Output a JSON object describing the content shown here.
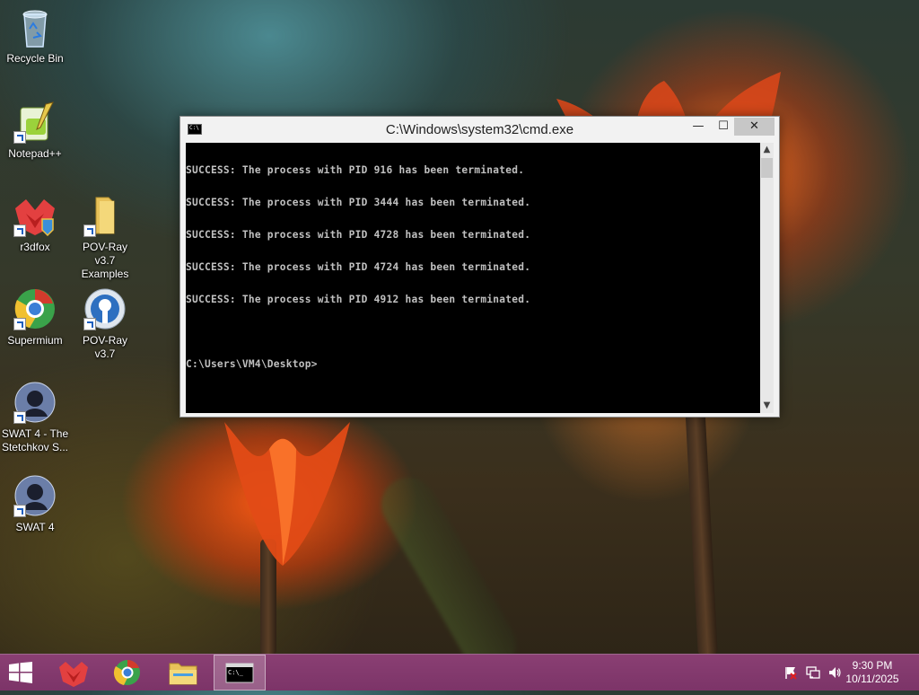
{
  "desktop": {
    "icons": [
      {
        "label": "Recycle Bin",
        "icon": "recycle-bin-icon"
      },
      {
        "label": "Notepad++",
        "icon": "notepad-plus-plus-icon"
      },
      {
        "label": "r3dfox",
        "icon": "r3dfox-icon"
      },
      {
        "label": "POV-Ray v3.7 Examples",
        "icon": "folder-icon"
      },
      {
        "label": "Supermium",
        "icon": "supermium-icon"
      },
      {
        "label": "POV-Ray v3.7",
        "icon": "pov-ray-icon"
      },
      {
        "label": "SWAT 4 - The Stetchkov S...",
        "icon": "swat4-icon"
      },
      {
        "label": "SWAT 4",
        "icon": "swat4-icon"
      }
    ]
  },
  "cmd_window": {
    "title": "C:\\Windows\\system32\\cmd.exe",
    "controls": {
      "minimize": "—",
      "maximize": "☐",
      "close": "✕"
    },
    "lines": [
      "SUCCESS: The process with PID 916 has been terminated.",
      "SUCCESS: The process with PID 3444 has been terminated.",
      "SUCCESS: The process with PID 4728 has been terminated.",
      "SUCCESS: The process with PID 4724 has been terminated.",
      "SUCCESS: The process with PID 4912 has been terminated.",
      "",
      "C:\\Users\\VM4\\Desktop>"
    ]
  },
  "taskbar": {
    "pinned": [
      "r3dfox-icon",
      "supermium-icon",
      "file-explorer-icon",
      "cmd-icon"
    ],
    "active": "cmd-icon",
    "tray": [
      "action-center-flag-icon",
      "network-icon",
      "volume-icon"
    ],
    "time": "9:30 PM",
    "date": "10/11/2025"
  },
  "colors": {
    "taskbar": "#7c3468",
    "console_bg": "#000000",
    "console_text": "#c0c0c0"
  }
}
